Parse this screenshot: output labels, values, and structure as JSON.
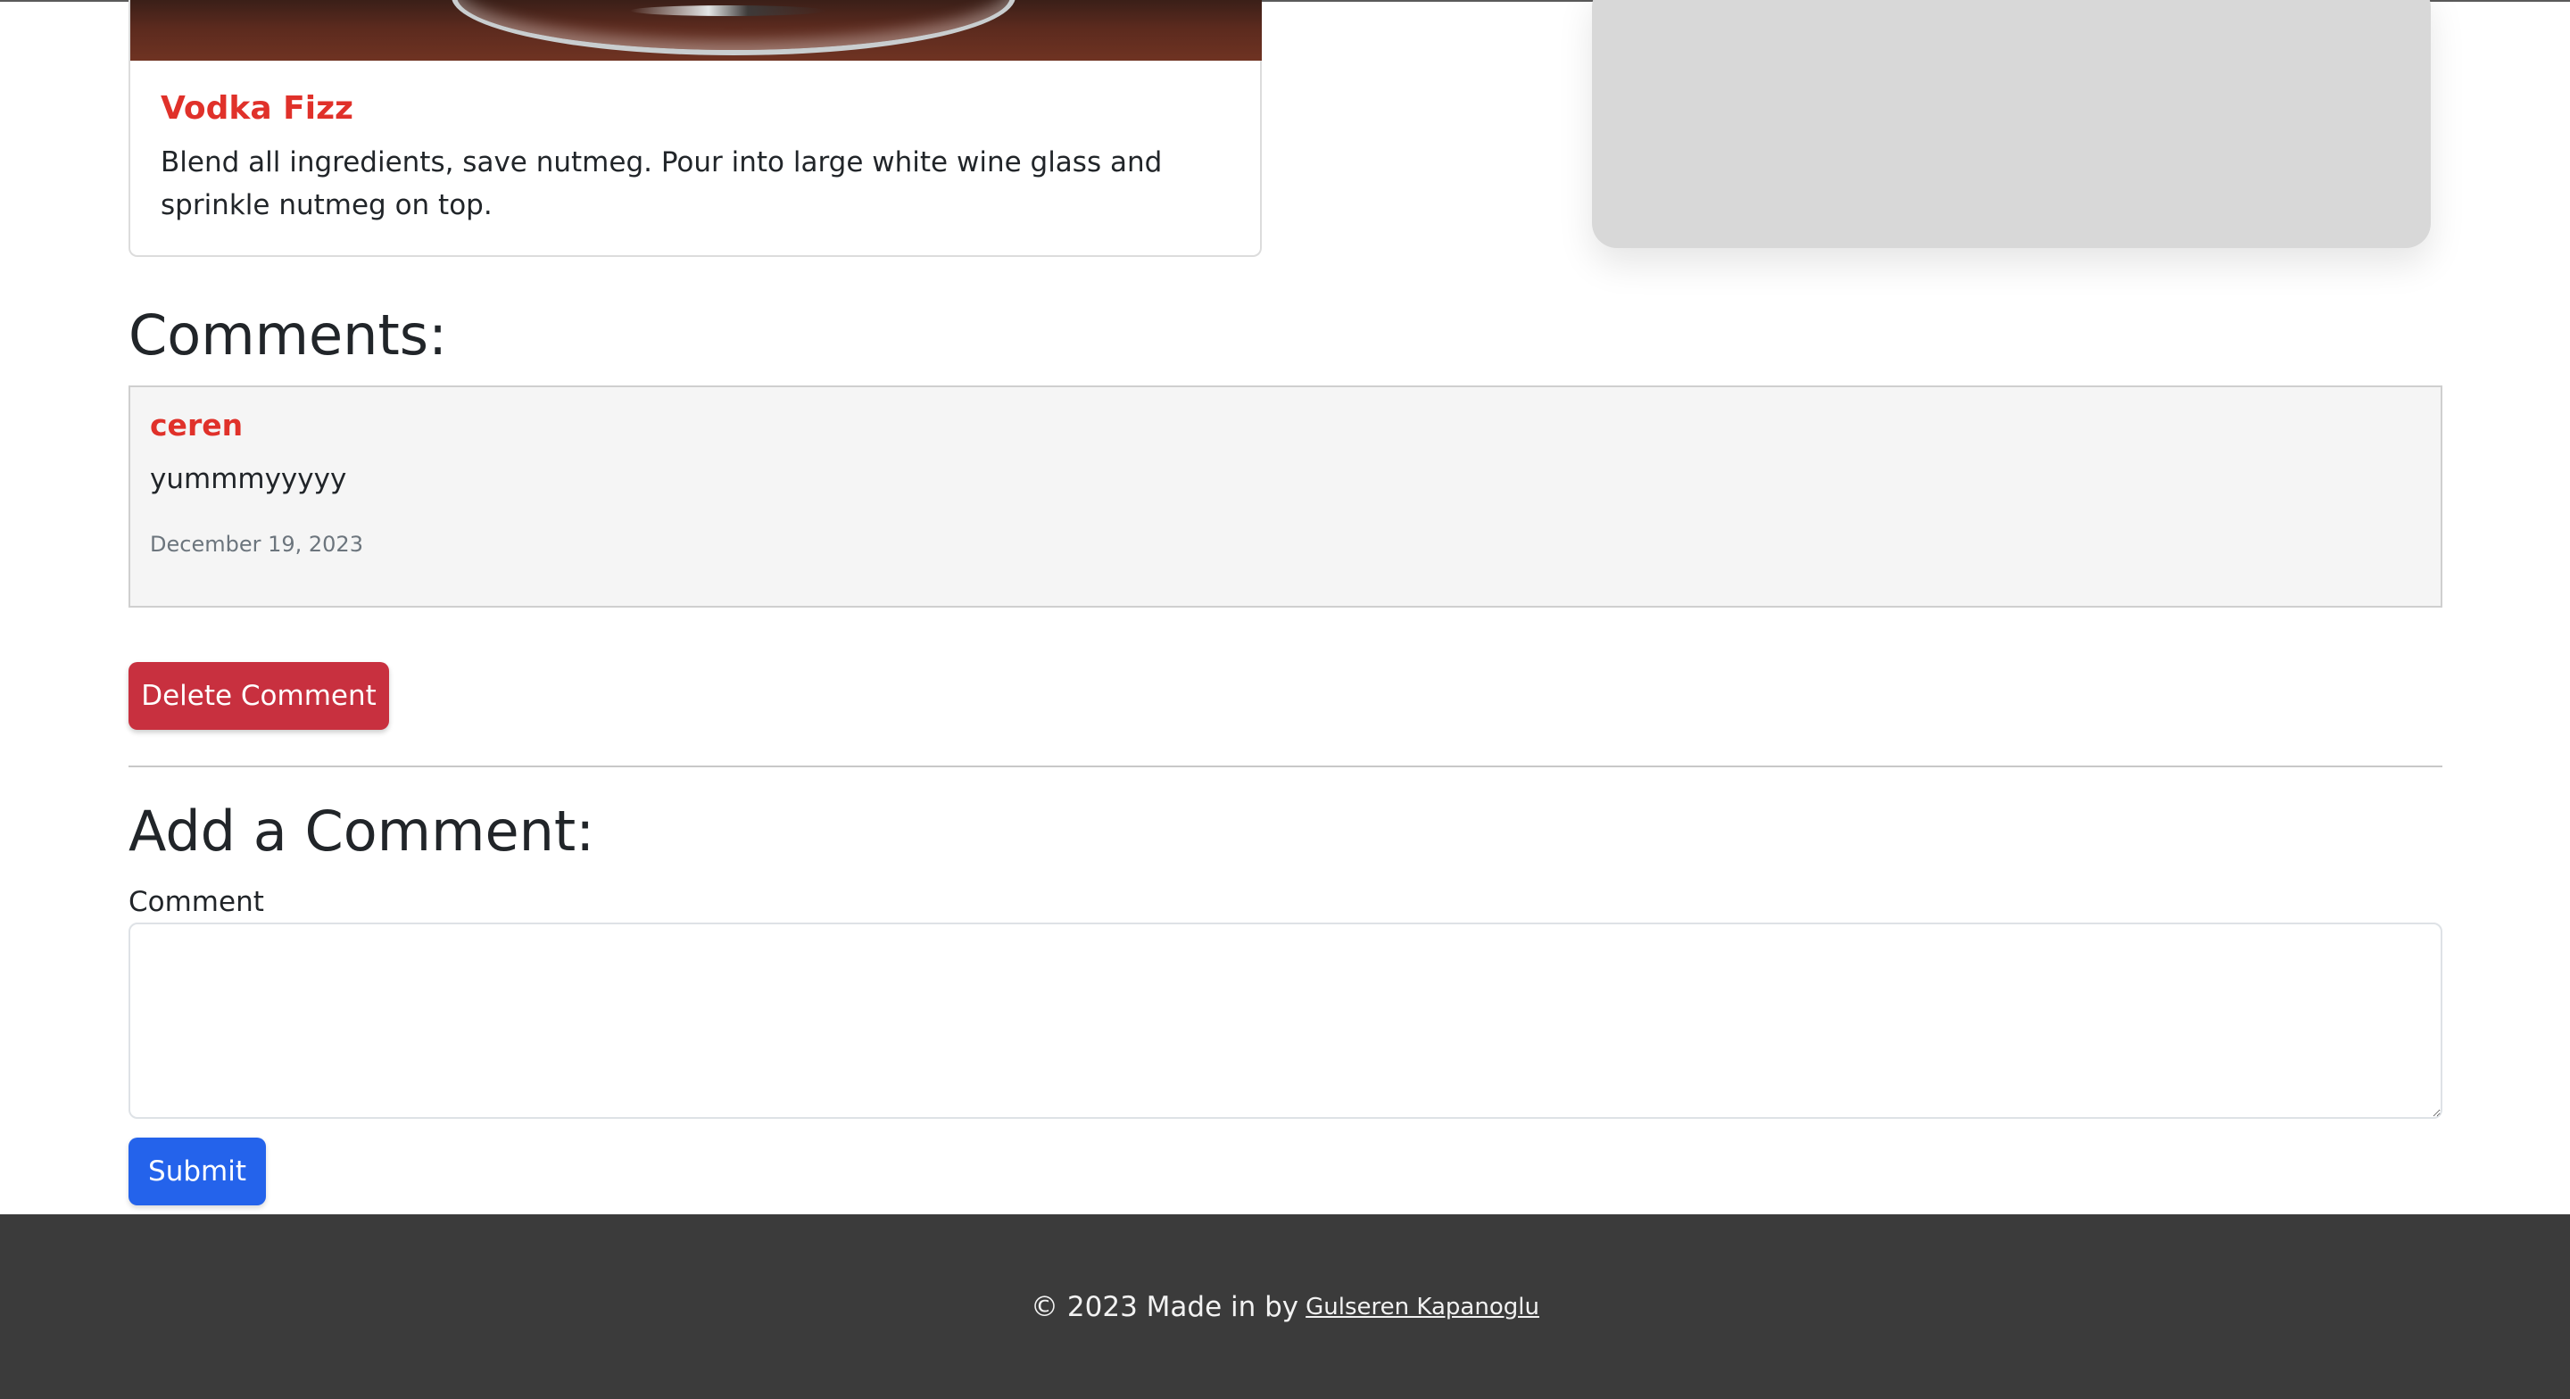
{
  "recipe": {
    "title": "Vodka Fizz",
    "description": "Blend all ingredients, save nutmeg. Pour into large white wine glass and sprinkle nutmeg on top."
  },
  "comments": {
    "heading": "Comments:",
    "items": [
      {
        "author": "ceren",
        "body": "yummmyyyyy",
        "date": "December 19, 2023"
      }
    ],
    "delete_label": "Delete Comment"
  },
  "add_comment": {
    "heading": "Add a Comment:",
    "field_label": "Comment",
    "field_value": "",
    "submit_label": "Submit"
  },
  "footer": {
    "text": "© 2023 Made in by",
    "link_text": "Gulseren Kapanoglu"
  },
  "colors": {
    "accent_red": "#e0312a",
    "delete_button": "#c8303f",
    "submit_button": "#2463eb",
    "footer_bg": "#3b3b3b",
    "comment_bg": "#f5f5f5"
  }
}
